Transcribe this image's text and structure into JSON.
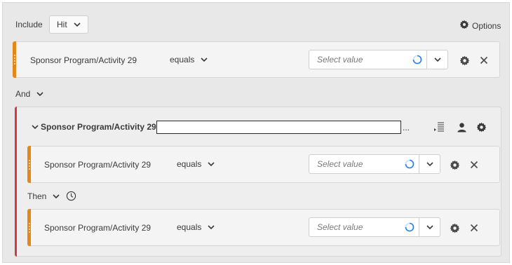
{
  "header": {
    "include_label": "Include",
    "scope_value": "Hit",
    "options_label": "Options"
  },
  "rules": [
    {
      "dimension": "Sponsor Program/Activity 29",
      "operator": "equals",
      "placeholder": "Select value"
    },
    {
      "dimension": "Sponsor Program/Activity 29",
      "operator": "equals",
      "placeholder": "Select value"
    },
    {
      "dimension": "Sponsor Program/Activity 29",
      "operator": "equals",
      "placeholder": "Select value"
    }
  ],
  "logic": {
    "and_label": "And",
    "then_label": "Then"
  },
  "container": {
    "title": "Sponsor Program/Activity 29 =",
    "name_value": "",
    "ellipsis": "..."
  },
  "colors": {
    "rule_accent": "#e68619",
    "container_accent": "#d7373f",
    "spinner": "#2680eb"
  },
  "icons": [
    "gear-icon",
    "close-icon",
    "chevron-down-icon",
    "loading-spinner-icon",
    "user-icon",
    "list-settings-icon",
    "clock-icon",
    "drag-handle-icon"
  ]
}
